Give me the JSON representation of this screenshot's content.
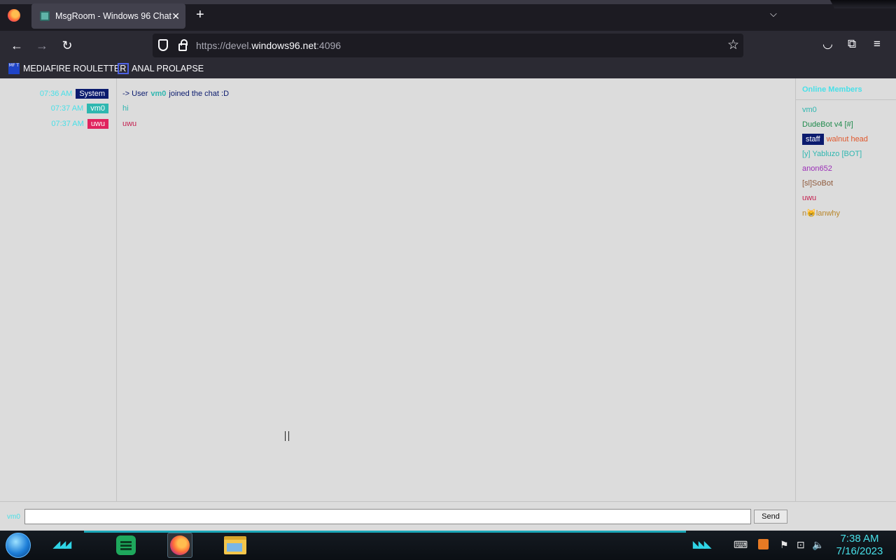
{
  "browser": {
    "tab_title": "MsgRoom - Windows 96 Chat",
    "close_glyph": "✕",
    "newtab_glyph": "+",
    "tablist_glyph": "⌵",
    "url_prefix": "https://devel.",
    "url_host": "windows96.net",
    "url_suffix": ":4096",
    "bookmarks": [
      {
        "label": "MEDIAFIRE ROULETTER",
        "icon_text": "MF T"
      },
      {
        "label": "ANAL PROLAPSE"
      }
    ],
    "glyphs": {
      "back": "←",
      "forward": "→",
      "reload": "↻",
      "star": "☆",
      "pocket": "◡",
      "extensions": "⧉",
      "menu": "≡"
    }
  },
  "chat": {
    "messages": [
      {
        "time": "07:36 AM",
        "user": "System",
        "badge_color": "#0b1b6e",
        "pre": "-> User",
        "strong": "vm0",
        "post": "joined the chat :D",
        "text_color": "#0b1b6e"
      },
      {
        "time": "07:37 AM",
        "user": "vm0",
        "badge_color": "#2fb7b0",
        "text": "hi",
        "text_color": "#2fb7b0"
      },
      {
        "time": "07:37 AM",
        "user": "uwu",
        "badge_color": "#e0245e",
        "text": "uwu",
        "text_color": "#c4204f"
      }
    ],
    "members_header": "Online Members",
    "members": [
      {
        "name": "vm0",
        "color": "#2fb7b0"
      },
      {
        "name": "DudeBot v4 [#]",
        "color": "#1f8a4c"
      },
      {
        "name": "walnut head",
        "color": "#e0572b",
        "badge": "staff"
      },
      {
        "name": "[y] Yabluzo [BOT]",
        "color": "#2fb7b0"
      },
      {
        "name": "anon652",
        "color": "#9b2fb7"
      },
      {
        "name": "[sl]SoBot",
        "color": "#8f5a3c"
      },
      {
        "name": "uwu",
        "color": "#c4204f"
      },
      {
        "name": "n😸lanwhy",
        "color": "#b8862b"
      }
    ],
    "input": {
      "nick": "vm0",
      "value": "",
      "send_label": "Send"
    }
  },
  "taskbar": {
    "chevrons_left": "◢◢◢",
    "chevrons_right": "◣◣◣",
    "time": "7:38 AM",
    "date": "7/16/2023",
    "tray_glyphs": {
      "keyboard": "⌨",
      "flag": "⚑",
      "network": "⊡",
      "volume": "🔈"
    }
  }
}
